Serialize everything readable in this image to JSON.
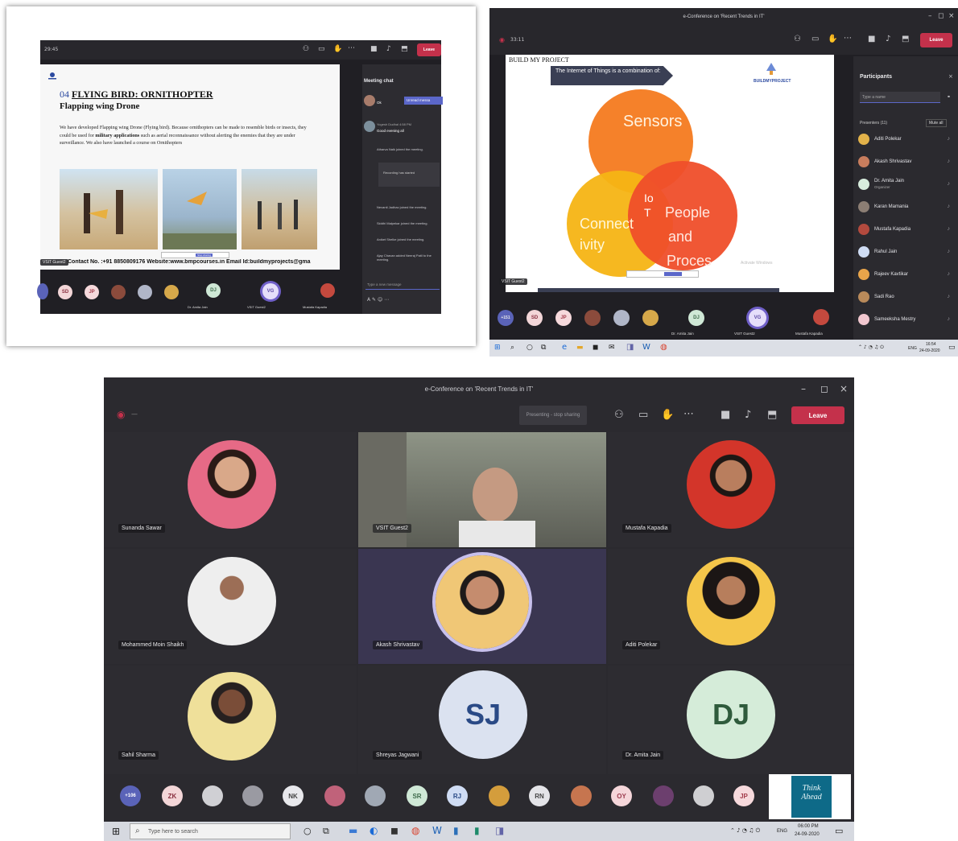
{
  "panel1": {
    "timer": "29:45",
    "slide": {
      "heading_num": "04",
      "heading": "FLYING BIRD: ORNITHOPTER",
      "subheading": "Flapping wing Drone",
      "body_1": "We have developed Flapping wing Drone (Flying bird). Because ornithopters can be made to resemble birds or insects, they could be used for",
      "body_bold": "military applications",
      "body_2": "such as aerial reconnaissance without alerting the enemies that they are under surveillance. We also have launched a course on Ornithopters",
      "contact": "Contact No. :+91 8850809176  Website:www.bmpcourses.in  Email Id:buildmyprojects@gma"
    },
    "leave_label": "Leave",
    "chat": {
      "title": "Meeting chat",
      "unread": "Unread messa",
      "msg1_author": "Yogesh Dudhal  4:58 PM",
      "msg1_text": "Good evening all",
      "msg0_text": "Ok",
      "ev1": "Atharva Naik joined the meeting.",
      "ev2": "Recording has started",
      "ev3": "Nevanti Jadhav joined the meeting.",
      "ev4": "Siddhi Malpekar joined the meeting.",
      "ev5": "Aniket Shelke joined the meeting.",
      "ev6": "Ajay Chavan added Neeraj Patil to the meeting.",
      "compose": "Type a new message"
    },
    "share_label": "Stop sharing",
    "guest_chip": "VSIT Guest2",
    "strip": [
      "SD",
      "JP",
      "DJ",
      "VG"
    ],
    "strip_names": [
      "Dr. Amita Jain",
      "VSIT Guest2",
      "Mustafa Kapadia"
    ]
  },
  "panel2": {
    "window_title": "e-Conference on 'Recent Trends in IT'",
    "timer": "33:11",
    "leave_label": "Leave",
    "slide": {
      "brand_head": "BUILD MY PROJECT",
      "callout": "The Internet of Things is a combination of:",
      "logo_text": "BUILDMYPROJECT",
      "c_sensors": "Sensors",
      "c_connect_1": "Connect",
      "c_connect_2": "ivity",
      "c_people_1": "People",
      "c_people_2": "and",
      "c_people_3": "Proces",
      "c_iot_1": "Io",
      "c_iot_2": "T",
      "watermark": "Activate Windows"
    },
    "guest_chip": "VSIT Guest2",
    "participants": {
      "title": "Participants",
      "search_placeholder": "Type a name",
      "presenters": "Presenters (11)",
      "mute_all": "Mute all",
      "people": [
        {
          "name": "Aditi Polekar",
          "role": ""
        },
        {
          "name": "Akash Shrivastav",
          "role": ""
        },
        {
          "name": "Dr. Amita Jain",
          "role": "Organizer"
        },
        {
          "name": "Karan Mamania",
          "role": ""
        },
        {
          "name": "Mustafa Kapadia",
          "role": ""
        },
        {
          "name": "Rahul Jain",
          "role": ""
        },
        {
          "name": "Rajeev Kavtikar",
          "role": ""
        },
        {
          "name": "Sadi Rao",
          "role": ""
        },
        {
          "name": "Sameeksha Mestry",
          "role": ""
        }
      ]
    },
    "strip": [
      "+151",
      "SD",
      "JP",
      "DJ",
      "VG"
    ],
    "strip_names": [
      "Dr. Amita Jain",
      "VSIT Guest2",
      "Mustafa Kapadia"
    ],
    "clock": "16:54",
    "date": "24-09-2020",
    "lang": "ENG"
  },
  "panel3": {
    "window_title": "e-Conference on 'Recent Trends in IT'",
    "leave_label": "Leave",
    "stop_label": "Presenting - stop sharing",
    "tiles": [
      {
        "name": "Sunanda Sawar"
      },
      {
        "name": "VSIT Guest2"
      },
      {
        "name": "Mustafa Kapadia"
      },
      {
        "name": "Mohammed Moin Shaikh"
      },
      {
        "name": "Akash Shrivastav"
      },
      {
        "name": "Aditi Polekar"
      },
      {
        "name": "Sahil Sharma"
      },
      {
        "name": "Shreyas Jagwani"
      },
      {
        "name": "Dr. Amita Jain"
      }
    ],
    "initials_sj": "SJ",
    "initials_dj": "DJ",
    "strip": [
      "+106",
      "ZK",
      "",
      "",
      "NK",
      "",
      "",
      "SR",
      "RJ",
      "",
      "RN",
      "",
      "OY",
      "",
      "",
      "JP"
    ],
    "search_text": "Type here to search",
    "clock": "06:00 PM",
    "date": "24-09-2020",
    "lang": "ENG",
    "promo": "Think Ahead"
  }
}
